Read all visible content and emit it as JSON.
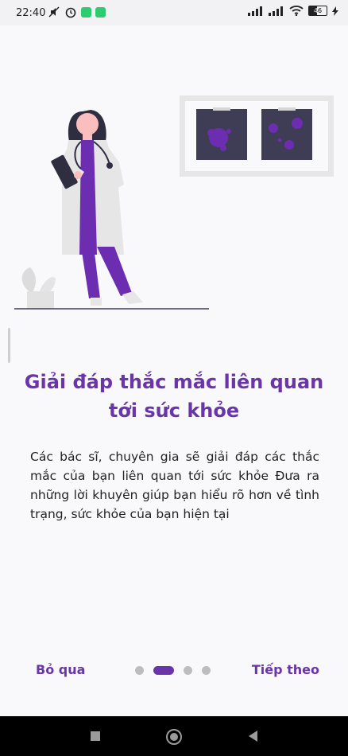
{
  "status": {
    "time": "22:40",
    "battery": "46"
  },
  "onboarding": {
    "title": "Giải đáp thắc mắc liên quan tới sức khỏe",
    "description": "Các bác sĩ, chuyên gia sẽ giải đáp các thắc mắc của bạn liên quan tới sức khỏe Đưa ra những lời khuyên giúp bạn hiểu rõ hơn về tình trạng, sức khỏe của bạn hiện tại",
    "skip_label": "Bỏ qua",
    "next_label": "Tiếp theo",
    "page_index": 2,
    "page_count": 4
  },
  "colors": {
    "accent": "#6a35a8",
    "dot_inactive": "#bdbdbd"
  }
}
